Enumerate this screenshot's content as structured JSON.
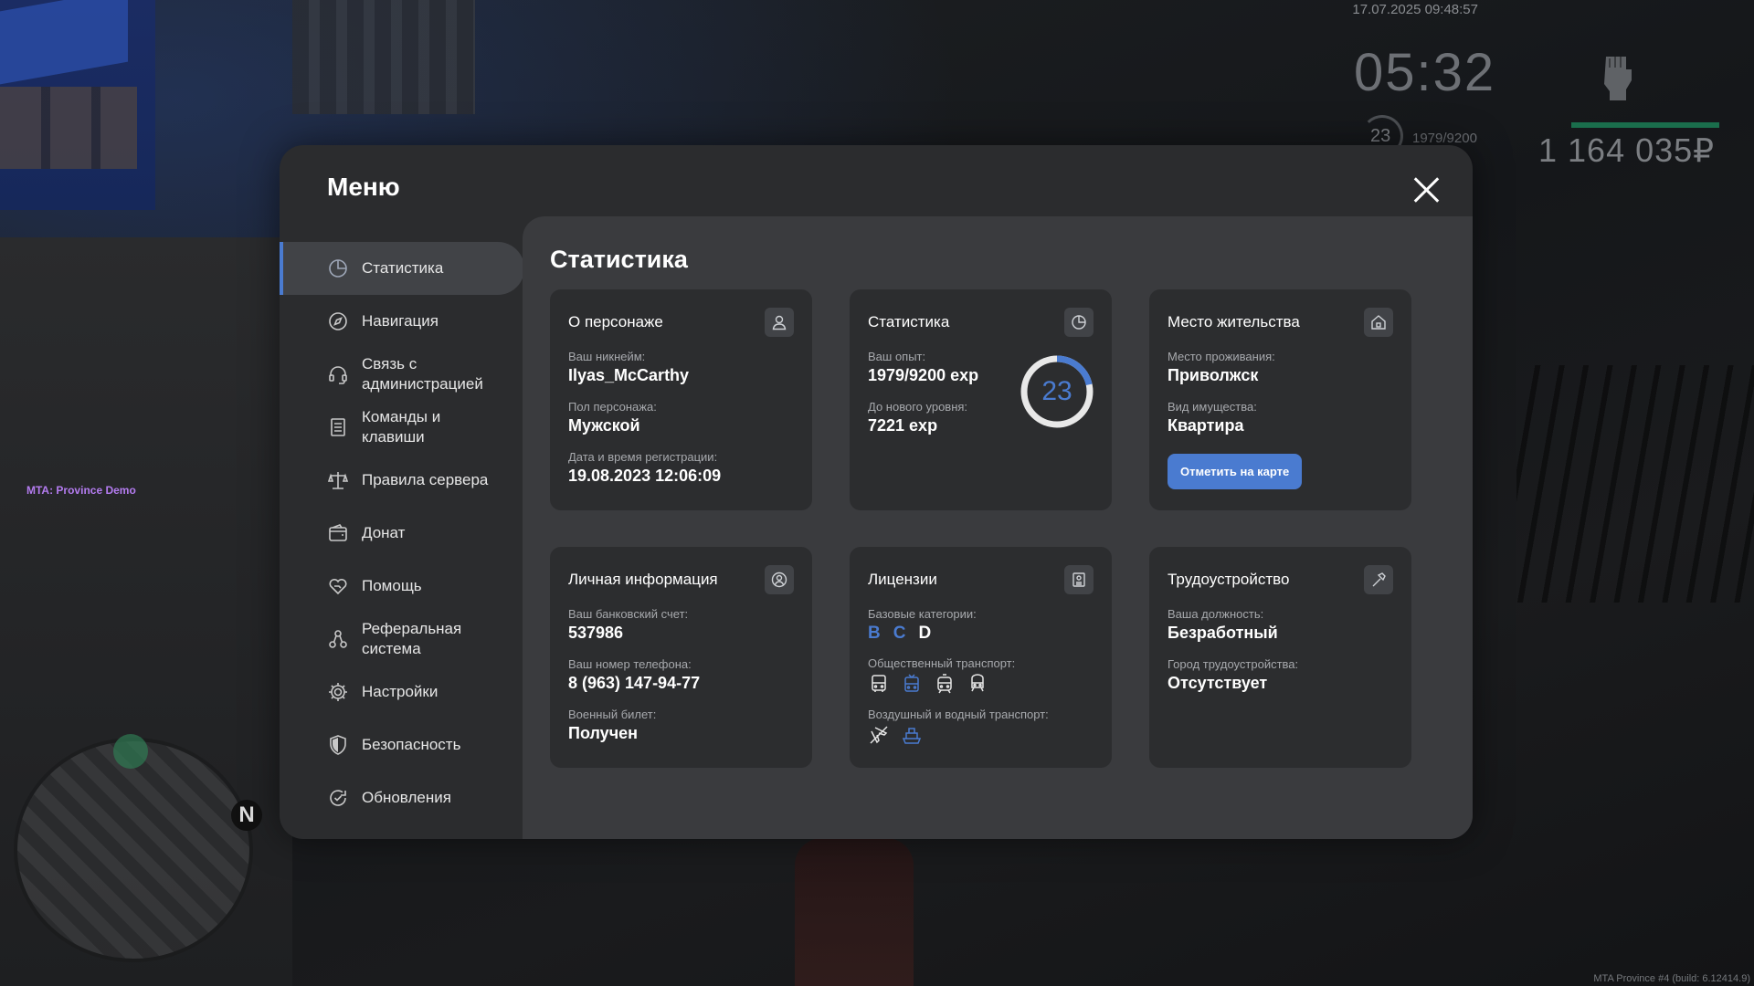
{
  "hud": {
    "datetime": "17.07.2025 09:48:57",
    "clock": "05:32",
    "level": "23",
    "xp": "1979/9200",
    "money": "1 164 035₽",
    "server_tag": "MTA: Province Demo",
    "build_info": "MTA Province #4 (build: 6.12414.9)",
    "minimap_north": "N"
  },
  "menu": {
    "title": "Меню",
    "items": [
      {
        "label": "Статистика",
        "icon": "pie-chart-icon",
        "active": true
      },
      {
        "label": "Навигация",
        "icon": "compass-icon"
      },
      {
        "label": "Связь с администрацией",
        "icon": "headset-icon"
      },
      {
        "label": "Команды и клавиши",
        "icon": "document-icon"
      },
      {
        "label": "Правила сервера",
        "icon": "scales-icon"
      },
      {
        "label": "Донат",
        "icon": "wallet-icon"
      },
      {
        "label": "Помощь",
        "icon": "heart-hand-icon"
      },
      {
        "label": "Реферальная система",
        "icon": "referral-icon"
      },
      {
        "label": "Настройки",
        "icon": "gear-icon"
      },
      {
        "label": "Безопасность",
        "icon": "shield-icon"
      },
      {
        "label": "Обновления",
        "icon": "refresh-check-icon"
      }
    ]
  },
  "stats": {
    "title": "Статистика",
    "character": {
      "title": "О персонаже",
      "nickname_label": "Ваш никнейм:",
      "nickname": "Ilyas_McCarthy",
      "gender_label": "Пол персонажа:",
      "gender": "Мужской",
      "reg_label": "Дата и время регистрации:",
      "reg": "19.08.2023 12:06:09"
    },
    "statistics": {
      "title": "Статистика",
      "xp_label": "Ваш опыт:",
      "xp": "1979/9200 exp",
      "next_label": "До нового уровня:",
      "next": "7221 exp",
      "level": "23",
      "progress": 0.215
    },
    "residence": {
      "title": "Место жительства",
      "place_label": "Место проживания:",
      "place": "Приволжск",
      "property_label": "Вид имущества:",
      "property": "Квартира",
      "map_button": "Отметить на карте"
    },
    "personal": {
      "title": "Личная информация",
      "bank_label": "Ваш банковский счет:",
      "bank": "537986",
      "phone_label": "Ваш номер телефона:",
      "phone": "8 (963) 147-94-77",
      "military_label": "Военный билет:",
      "military": "Получен"
    },
    "licenses": {
      "title": "Лицензии",
      "base_label": "Базовые категории:",
      "cat_b": "B",
      "cat_c": "C",
      "cat_d": "D",
      "public_label": "Общественный транспорт:",
      "air_label": "Воздушный и водный транспорт:"
    },
    "job": {
      "title": "Трудоустройство",
      "position_label": "Ваша должность:",
      "position": "Безработный",
      "city_label": "Город трудоустройства:",
      "city": "Отсутствует"
    }
  },
  "colors": {
    "accent": "#4a7bd0",
    "panel": "#2b2c2e",
    "content": "#3a3b3e",
    "card": "#2c2d2f"
  }
}
